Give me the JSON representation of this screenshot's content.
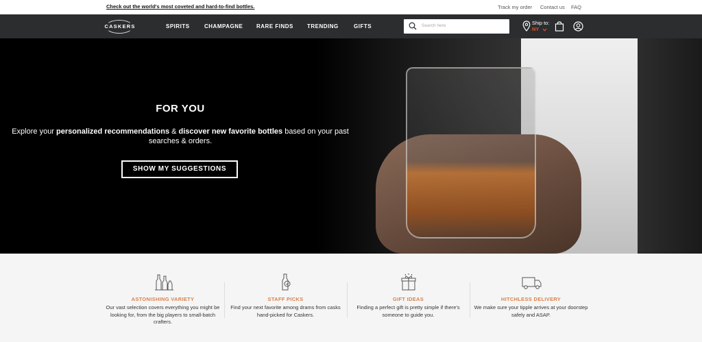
{
  "topbar": {
    "promo": "Check out the world's most coveted and hard-to-find bottles.",
    "links": [
      "Track my order",
      "Contact us",
      "FAQ"
    ]
  },
  "nav": {
    "logo": "CASKERS",
    "items": [
      "SPIRITS",
      "CHAMPAGNE",
      "RARE FINDS",
      "TRENDING",
      "GIFTS"
    ],
    "search_placeholder": "Search here",
    "ship_to_label": "Ship to:",
    "ship_to_state": "NY",
    "icons": [
      "search-icon",
      "location-pin-icon",
      "chevron-down-icon",
      "shopping-bag-icon",
      "account-icon"
    ]
  },
  "hero": {
    "title": "FOR YOU",
    "desc": {
      "p1": "Explore your ",
      "b1": "personalized recommendations",
      "p2": " & ",
      "b2": "discover new favorite bottles",
      "p3": " based on your past searches & orders."
    },
    "cta": "SHOW MY SUGGESTIONS"
  },
  "features": [
    {
      "title": "ASTONISHING VARIETY",
      "text": "Our vast selection covers everything you might be looking for, from the big players to small-batch crafters.",
      "icon": "bottles-icon"
    },
    {
      "title": "STAFF PICKS",
      "text": "Find your next favorite among drams from casks hand-picked for Caskers.",
      "icon": "bottle-badge-icon"
    },
    {
      "title": "GIFT IDEAS",
      "text": "Finding a perfect gift is pretty simple if there's someone to guide you.",
      "icon": "gift-icon"
    },
    {
      "title": "HITCHLESS DELIVERY",
      "text": "We make sure your tipple arrives at your doorstep safely and ASAP.",
      "icon": "delivery-truck-icon"
    }
  ],
  "colors": {
    "nav_bg": "#2b2d2f",
    "accent_orange": "#d9824a",
    "ship_state": "#e2512c",
    "features_bg": "#f5f5f5"
  }
}
